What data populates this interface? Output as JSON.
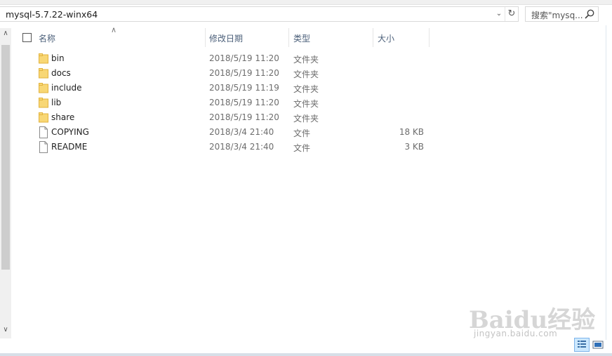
{
  "address": {
    "path": "mysql-5.7.22-winx64",
    "search_placeholder": "搜索\"mysq..."
  },
  "columns": {
    "name": "名称",
    "modified": "修改日期",
    "type": "类型",
    "size": "大小"
  },
  "files": [
    {
      "name": "bin",
      "modified": "2018/5/19 11:20",
      "type": "文件夹",
      "size": "",
      "icon": "folder-icon"
    },
    {
      "name": "docs",
      "modified": "2018/5/19 11:20",
      "type": "文件夹",
      "size": "",
      "icon": "folder-icon"
    },
    {
      "name": "include",
      "modified": "2018/5/19 11:19",
      "type": "文件夹",
      "size": "",
      "icon": "folder-icon"
    },
    {
      "name": "lib",
      "modified": "2018/5/19 11:20",
      "type": "文件夹",
      "size": "",
      "icon": "folder-icon"
    },
    {
      "name": "share",
      "modified": "2018/5/19 11:20",
      "type": "文件夹",
      "size": "",
      "icon": "folder-icon"
    },
    {
      "name": "COPYING",
      "modified": "2018/3/4 21:40",
      "type": "文件",
      "size": "18 KB",
      "icon": "file-icon"
    },
    {
      "name": "README",
      "modified": "2018/3/4 21:40",
      "type": "文件",
      "size": "3 KB",
      "icon": "file-icon"
    }
  ],
  "watermark": {
    "brand": "Baidu经验",
    "url": "jingyan.baidu.com"
  },
  "colors": {
    "folder": "#f8d775",
    "header_text": "#4c607a",
    "selected_view": "#cce8ff"
  }
}
